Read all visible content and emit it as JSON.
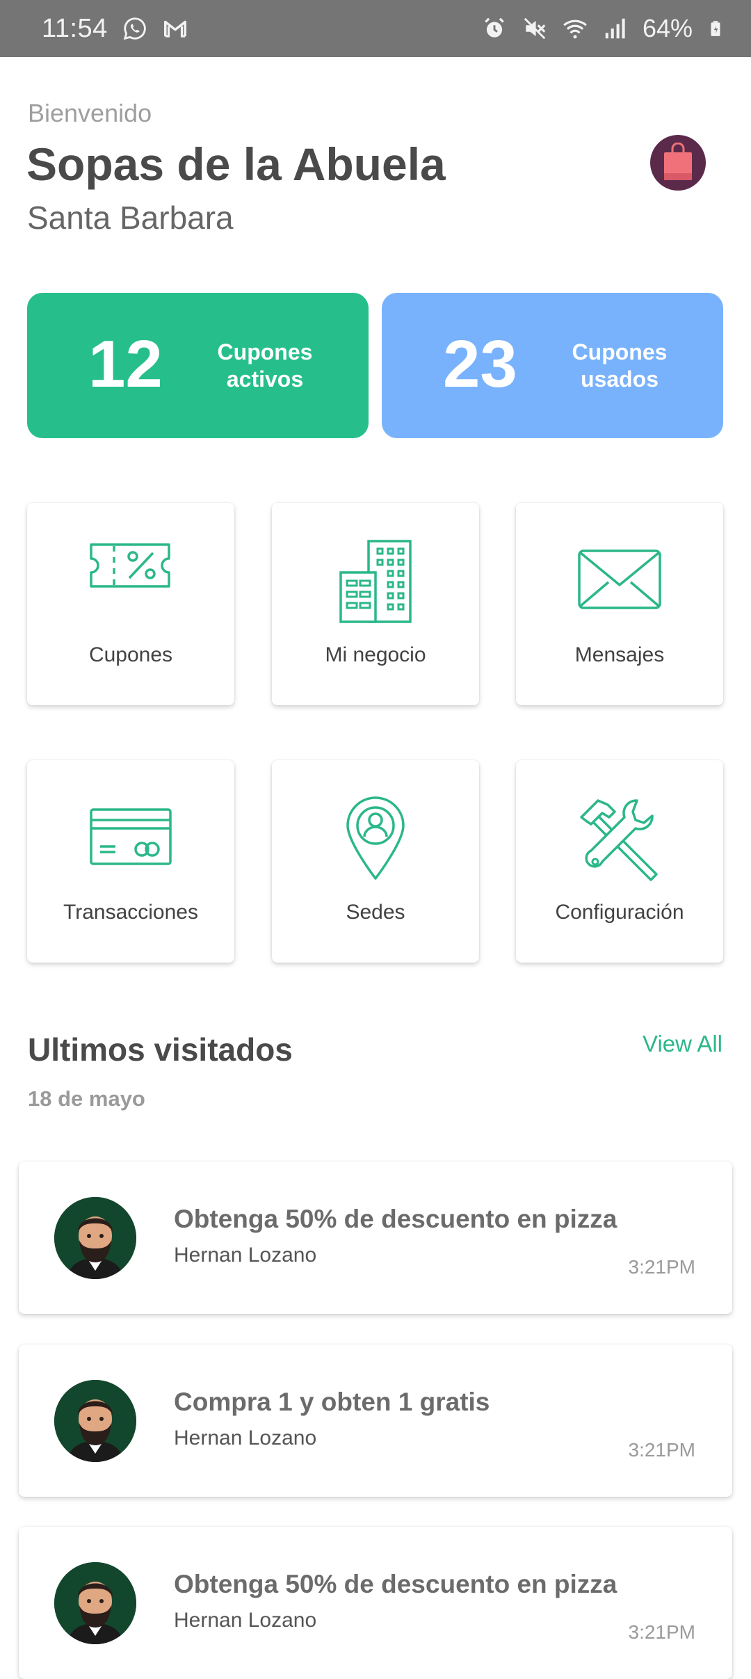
{
  "status_bar": {
    "time": "11:54",
    "battery": "64%",
    "left_icons": [
      "whatsapp-icon",
      "gmail-icon"
    ],
    "right_icons": [
      "alarm-icon",
      "mute-icon",
      "wifi-icon",
      "signal-icon",
      "battery-icon"
    ]
  },
  "header": {
    "welcome": "Bienvenido",
    "business_name": "Sopas de la Abuela",
    "city": "Santa Barbara",
    "logo_icon": "shopping-bag-icon"
  },
  "stats": [
    {
      "value": "12",
      "label_line1": "Cupones",
      "label_line2": "activos",
      "color": "#26bf8b"
    },
    {
      "value": "23",
      "label_line1": "Cupones",
      "label_line2": "usados",
      "color": "#78b2fc"
    }
  ],
  "menu": [
    {
      "label": "Cupones",
      "icon": "coupon-icon"
    },
    {
      "label": "Mi negocio",
      "icon": "building-icon"
    },
    {
      "label": "Mensajes",
      "icon": "envelope-icon"
    },
    {
      "label": "Transacciones",
      "icon": "credit-card-icon"
    },
    {
      "label": "Sedes",
      "icon": "location-pin-icon"
    },
    {
      "label": "Configuración",
      "icon": "tools-icon"
    }
  ],
  "recent": {
    "title": "Ultimos visitados",
    "view_all": "View All",
    "date": "18 de mayo",
    "items": [
      {
        "title": "Obtenga 50% de descuento en pizza",
        "user": "Hernan Lozano",
        "time": "3:21PM"
      },
      {
        "title": "Compra 1 y obten 1 gratis",
        "user": "Hernan Lozano",
        "time": "3:21PM"
      },
      {
        "title": "Obtenga 50% de descuento en pizza",
        "user": "Hernan Lozano",
        "time": "3:21PM"
      }
    ]
  },
  "colors": {
    "accent_green": "#26bf8b",
    "accent_blue": "#78b2fc",
    "status_bar": "#757575"
  }
}
